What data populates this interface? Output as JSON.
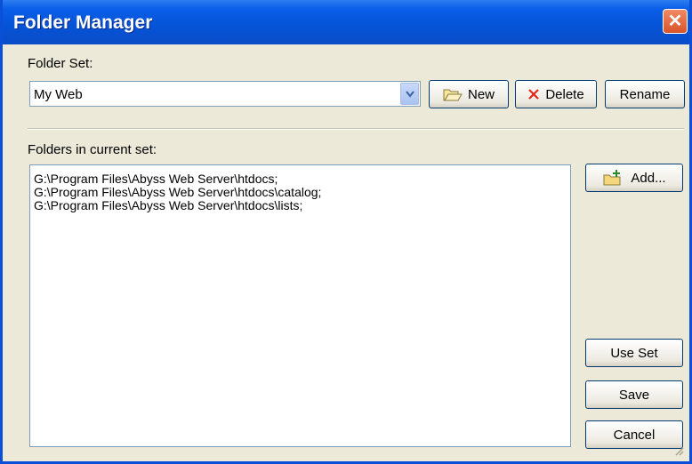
{
  "window": {
    "title": "Folder Manager",
    "close_glyph": "✕"
  },
  "folder_set": {
    "label": "Folder Set:",
    "selected": "My Web",
    "buttons": {
      "new": "New",
      "delete": "Delete",
      "rename": "Rename"
    }
  },
  "folders": {
    "label": "Folders in current set:",
    "items": [
      "G:\\Program Files\\Abyss Web Server\\htdocs;",
      "G:\\Program Files\\Abyss Web Server\\htdocs\\catalog;",
      "G:\\Program Files\\Abyss Web Server\\htdocs\\lists;"
    ],
    "add_label": "Add..."
  },
  "actions": {
    "use_set": "Use Set",
    "save": "Save",
    "cancel": "Cancel"
  },
  "icons": {
    "new": "folder-open-icon",
    "delete": "red-x-delete-icon",
    "add": "add-folder-icon",
    "dropdown": "chevron-down-icon",
    "close": "close-icon"
  },
  "colors": {
    "titlebar": "#0553d6",
    "close": "#d9542a",
    "dialog_bg": "#ece9d8",
    "delete_x": "#e0281a"
  }
}
